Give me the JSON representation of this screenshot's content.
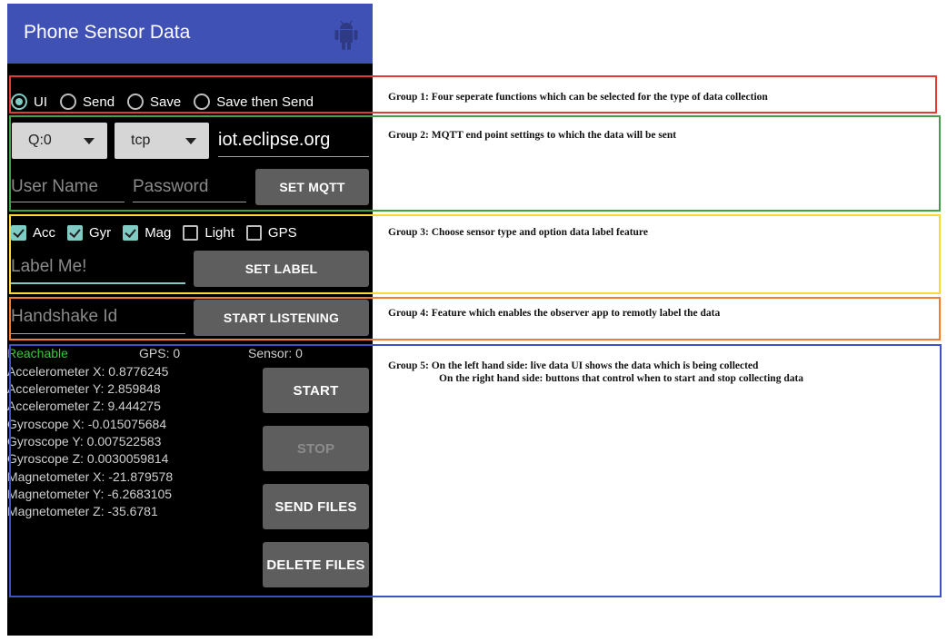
{
  "app": {
    "title": "Phone Sensor Data",
    "header_icon": "android-icon"
  },
  "group1": {
    "modes": [
      {
        "label": "UI",
        "selected": true
      },
      {
        "label": "Send",
        "selected": false
      },
      {
        "label": "Save",
        "selected": false
      },
      {
        "label": "Save then Send",
        "selected": false
      }
    ]
  },
  "group2": {
    "qos_spinner": "Q:0",
    "protocol_spinner": "tcp",
    "host": "iot.eclipse.org",
    "username_placeholder": "User Name",
    "password_placeholder": "Password",
    "set_mqtt": "SET MQTT"
  },
  "group3": {
    "sensors": [
      {
        "label": "Acc",
        "checked": true
      },
      {
        "label": "Gyr",
        "checked": true
      },
      {
        "label": "Mag",
        "checked": true
      },
      {
        "label": "Light",
        "checked": false
      },
      {
        "label": "GPS",
        "checked": false
      }
    ],
    "label_placeholder": "Label Me!",
    "set_label": "SET LABEL"
  },
  "group4": {
    "handshake_placeholder": "Handshake Id",
    "start_listening": "START LISTENING"
  },
  "group5": {
    "status": "Reachable",
    "gps": "GPS: 0",
    "sensor": "Sensor: 0",
    "readings": [
      "Accelerometer X: 0.8776245",
      "Accelerometer Y: 2.859848",
      "Accelerometer Z: 9.444275",
      "Gyroscope X: -0.015075684",
      "Gyroscope Y: 0.007522583",
      "Gyroscope Z: 0.0030059814",
      "Magnetometer X: -21.879578",
      "Magnetometer Y: -6.2683105",
      "Magnetometer Z: -35.6781"
    ],
    "buttons": {
      "start": "START",
      "stop": "STOP",
      "send_files": "SEND FILES",
      "delete_files": "DELETE FILES"
    }
  },
  "annotations": [
    {
      "text": "Group 1: Four seperate functions which can be selected for the type of data collection",
      "color": "#e53935"
    },
    {
      "text": "Group 2: MQTT end point settings to which the data will be sent",
      "color": "#43a047"
    },
    {
      "text": "Group 3: Choose sensor type and option data label feature",
      "color": "#fdd835"
    },
    {
      "text": "Group 4: Feature which enables the observer app to remotly label the data",
      "color": "#f57c2e"
    },
    {
      "text": "Group 5: On the left hand side: live data UI shows the data which is being collected",
      "text2": "On the right hand side: buttons that control when to start and stop collecting data",
      "color": "#3f51c5"
    }
  ]
}
